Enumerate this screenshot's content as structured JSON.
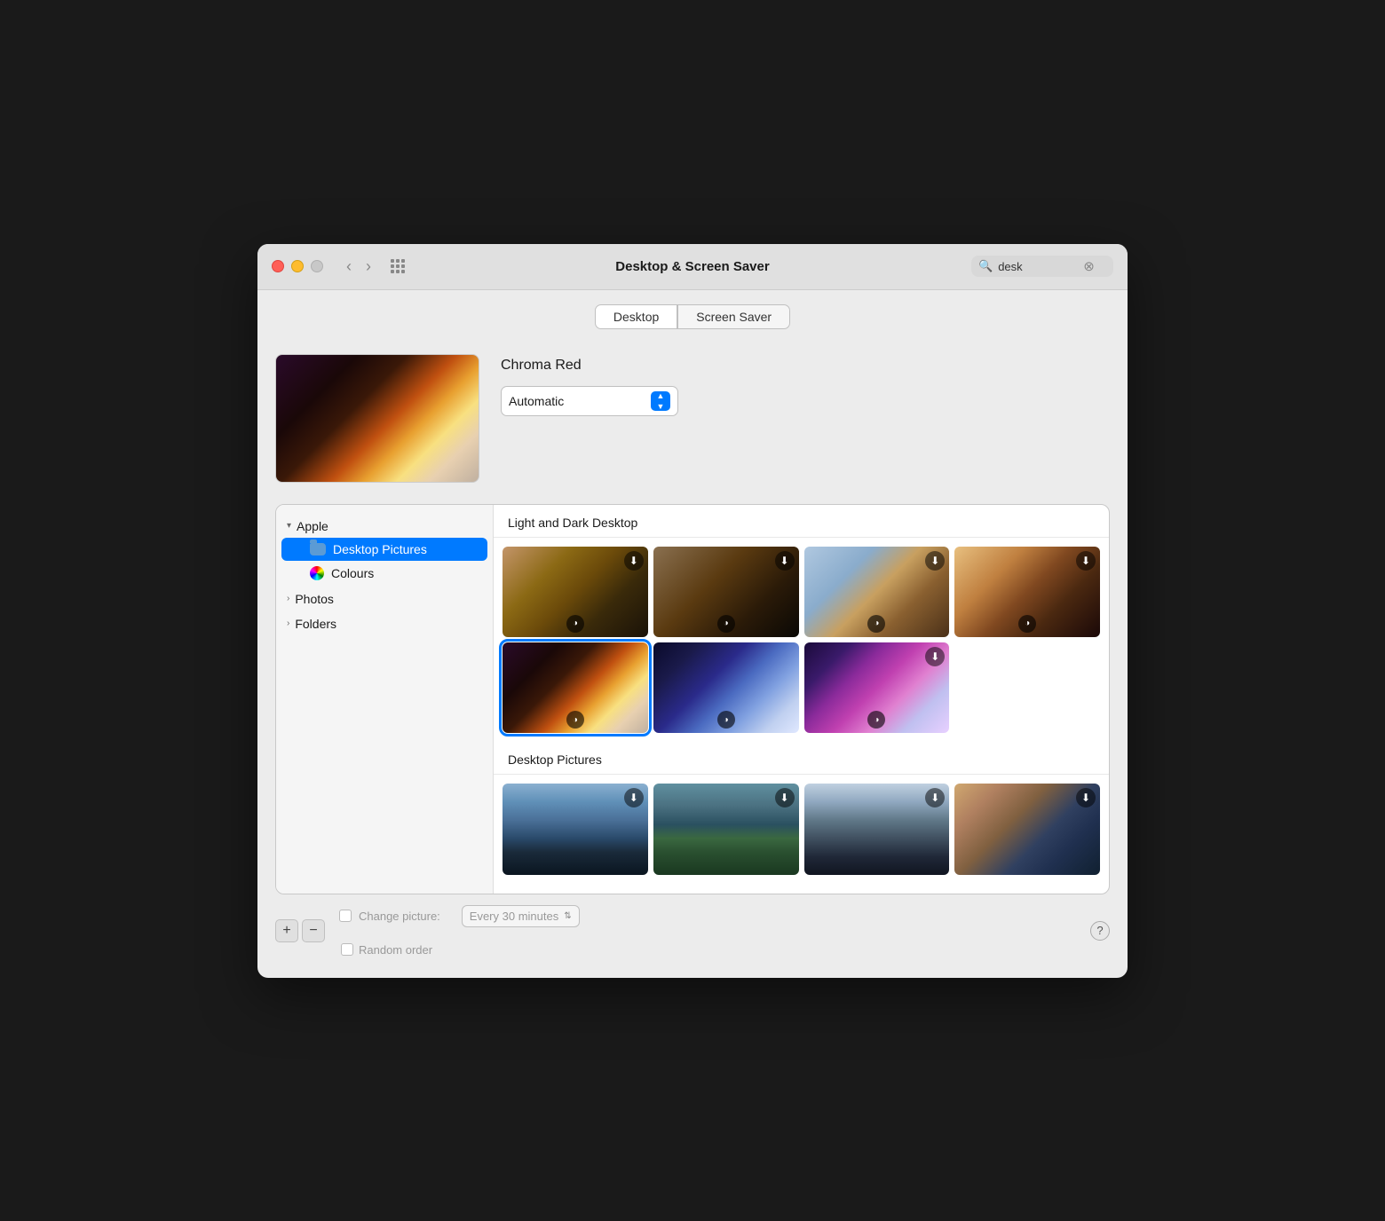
{
  "window": {
    "title": "Desktop & Screen Saver"
  },
  "titlebar": {
    "search_placeholder": "desk",
    "search_value": "desk",
    "back_label": "‹",
    "forward_label": "›"
  },
  "tabs": [
    {
      "id": "desktop",
      "label": "Desktop",
      "active": true
    },
    {
      "id": "screensaver",
      "label": "Screen Saver",
      "active": false
    }
  ],
  "preview": {
    "wallpaper_name": "Chroma Red",
    "mode_label": "Automatic",
    "dropdown_arrows": "⇅"
  },
  "sidebar": {
    "groups": [
      {
        "id": "apple",
        "label": "Apple",
        "expanded": true,
        "items": [
          {
            "id": "desktop-pictures",
            "label": "Desktop Pictures",
            "selected": true,
            "icon": "folder"
          },
          {
            "id": "colours",
            "label": "Colours",
            "selected": false,
            "icon": "colors"
          }
        ]
      },
      {
        "id": "photos",
        "label": "Photos",
        "expanded": false,
        "items": []
      },
      {
        "id": "folders",
        "label": "Folders",
        "expanded": false,
        "items": []
      }
    ]
  },
  "grid": {
    "sections": [
      {
        "id": "light-dark",
        "title": "Light and Dark Desktop",
        "wallpapers": [
          {
            "id": "sandstone-1",
            "theme": "wp-sandstone-light",
            "has_download": true,
            "has_mode": true,
            "selected": false
          },
          {
            "id": "sandstone-2",
            "theme": "wp-sandstone-dark",
            "has_download": true,
            "has_mode": true,
            "selected": false
          },
          {
            "id": "canyon-1",
            "theme": "wp-canyon-light",
            "has_download": true,
            "has_mode": true,
            "selected": false
          },
          {
            "id": "sunset-rock",
            "theme": "wp-sunset-rock",
            "has_download": true,
            "has_mode": true,
            "selected": false
          },
          {
            "id": "chroma-red",
            "theme": "wp-chroma-red",
            "has_download": false,
            "has_mode": true,
            "selected": true
          },
          {
            "id": "chroma-blue",
            "theme": "wp-chroma-blue",
            "has_download": false,
            "has_mode": true,
            "selected": false
          },
          {
            "id": "chroma-purple",
            "theme": "wp-chroma-purple",
            "has_download": true,
            "has_mode": true,
            "selected": false
          }
        ]
      },
      {
        "id": "desktop-pictures",
        "title": "Desktop Pictures",
        "wallpapers": [
          {
            "id": "mountains",
            "theme": "wp-mountains",
            "has_download": true,
            "has_mode": false,
            "selected": false
          },
          {
            "id": "coast-green",
            "theme": "wp-coast-green",
            "has_download": true,
            "has_mode": false,
            "selected": false
          },
          {
            "id": "ocean-rocks",
            "theme": "wp-ocean-rocks",
            "has_download": true,
            "has_mode": false,
            "selected": false
          },
          {
            "id": "coastal-cliffs",
            "theme": "wp-coastal-cliffs",
            "has_download": true,
            "has_mode": false,
            "selected": false
          }
        ]
      }
    ]
  },
  "bottom": {
    "add_label": "+",
    "remove_label": "−",
    "change_picture_label": "Change picture:",
    "interval_label": "Every 30 minutes",
    "random_order_label": "Random order",
    "help_label": "?"
  }
}
